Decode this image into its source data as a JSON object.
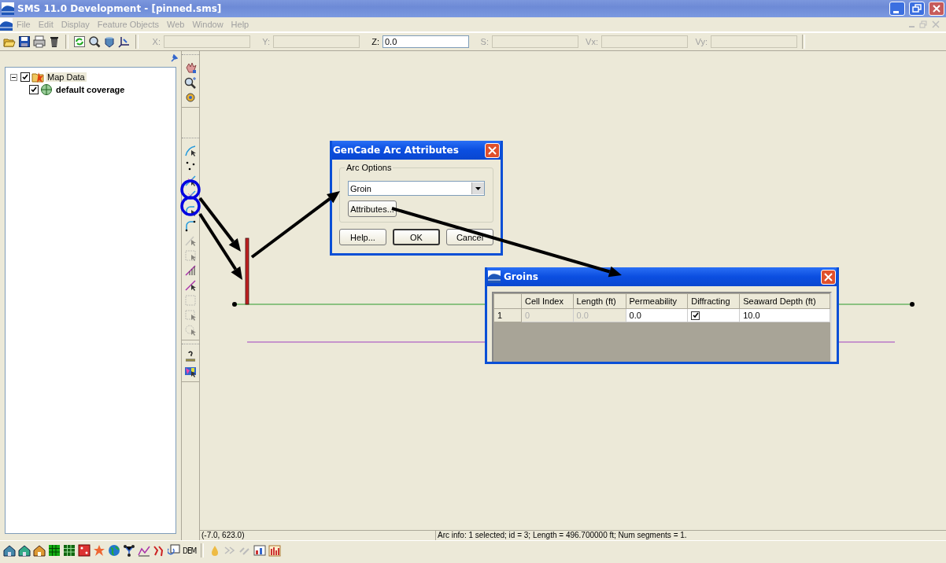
{
  "window": {
    "title": "SMS 11.0 Development - [pinned.sms]"
  },
  "menu": [
    "File",
    "Edit",
    "Display",
    "Feature Objects",
    "Web",
    "Window",
    "Help"
  ],
  "coordinate_fields": [
    {
      "label": "X:",
      "disabled": true
    },
    {
      "label": "Y:",
      "disabled": true
    },
    {
      "label": "Z:",
      "value": "0.0",
      "disabled": false
    },
    {
      "label": "S:",
      "disabled": true
    },
    {
      "label": "Vx:",
      "disabled": true
    },
    {
      "label": "Vy:",
      "disabled": true
    }
  ],
  "project_tree": [
    {
      "label": "Map Data",
      "checked": true,
      "expanded": true,
      "children": [
        {
          "label": "default coverage",
          "checked": true
        }
      ]
    }
  ],
  "arc_dialog": {
    "title": "GenCade Arc Attributes",
    "group": "Arc Options",
    "arc_type": "Groin",
    "attributes_button": "Attributes...",
    "buttons": [
      "Help...",
      "OK",
      "Cancel"
    ]
  },
  "groins_dialog": {
    "title": "Groins",
    "columns": [
      "Cell Index",
      "Length (ft)",
      "Permeability",
      "Diffracting",
      "Seaward Depth (ft)"
    ],
    "rows": [
      {
        "header": "1",
        "cells": [
          {
            "kind": "text",
            "value": "0",
            "disabled": true
          },
          {
            "kind": "text",
            "value": "0.0",
            "disabled": true
          },
          {
            "kind": "text",
            "value": "0.0",
            "disabled": false
          },
          {
            "kind": "checkbox",
            "checked": true
          },
          {
            "kind": "text",
            "value": "10.0",
            "disabled": false
          }
        ]
      }
    ]
  },
  "status_bar": {
    "coordinates": "(-7.0, 623.0)",
    "info": "Arc info: 1 selected; id = 3; Length = 496.700000 ft; Num segments = 1."
  },
  "bottom_toolbar": {
    "dem_label": "DEM"
  }
}
